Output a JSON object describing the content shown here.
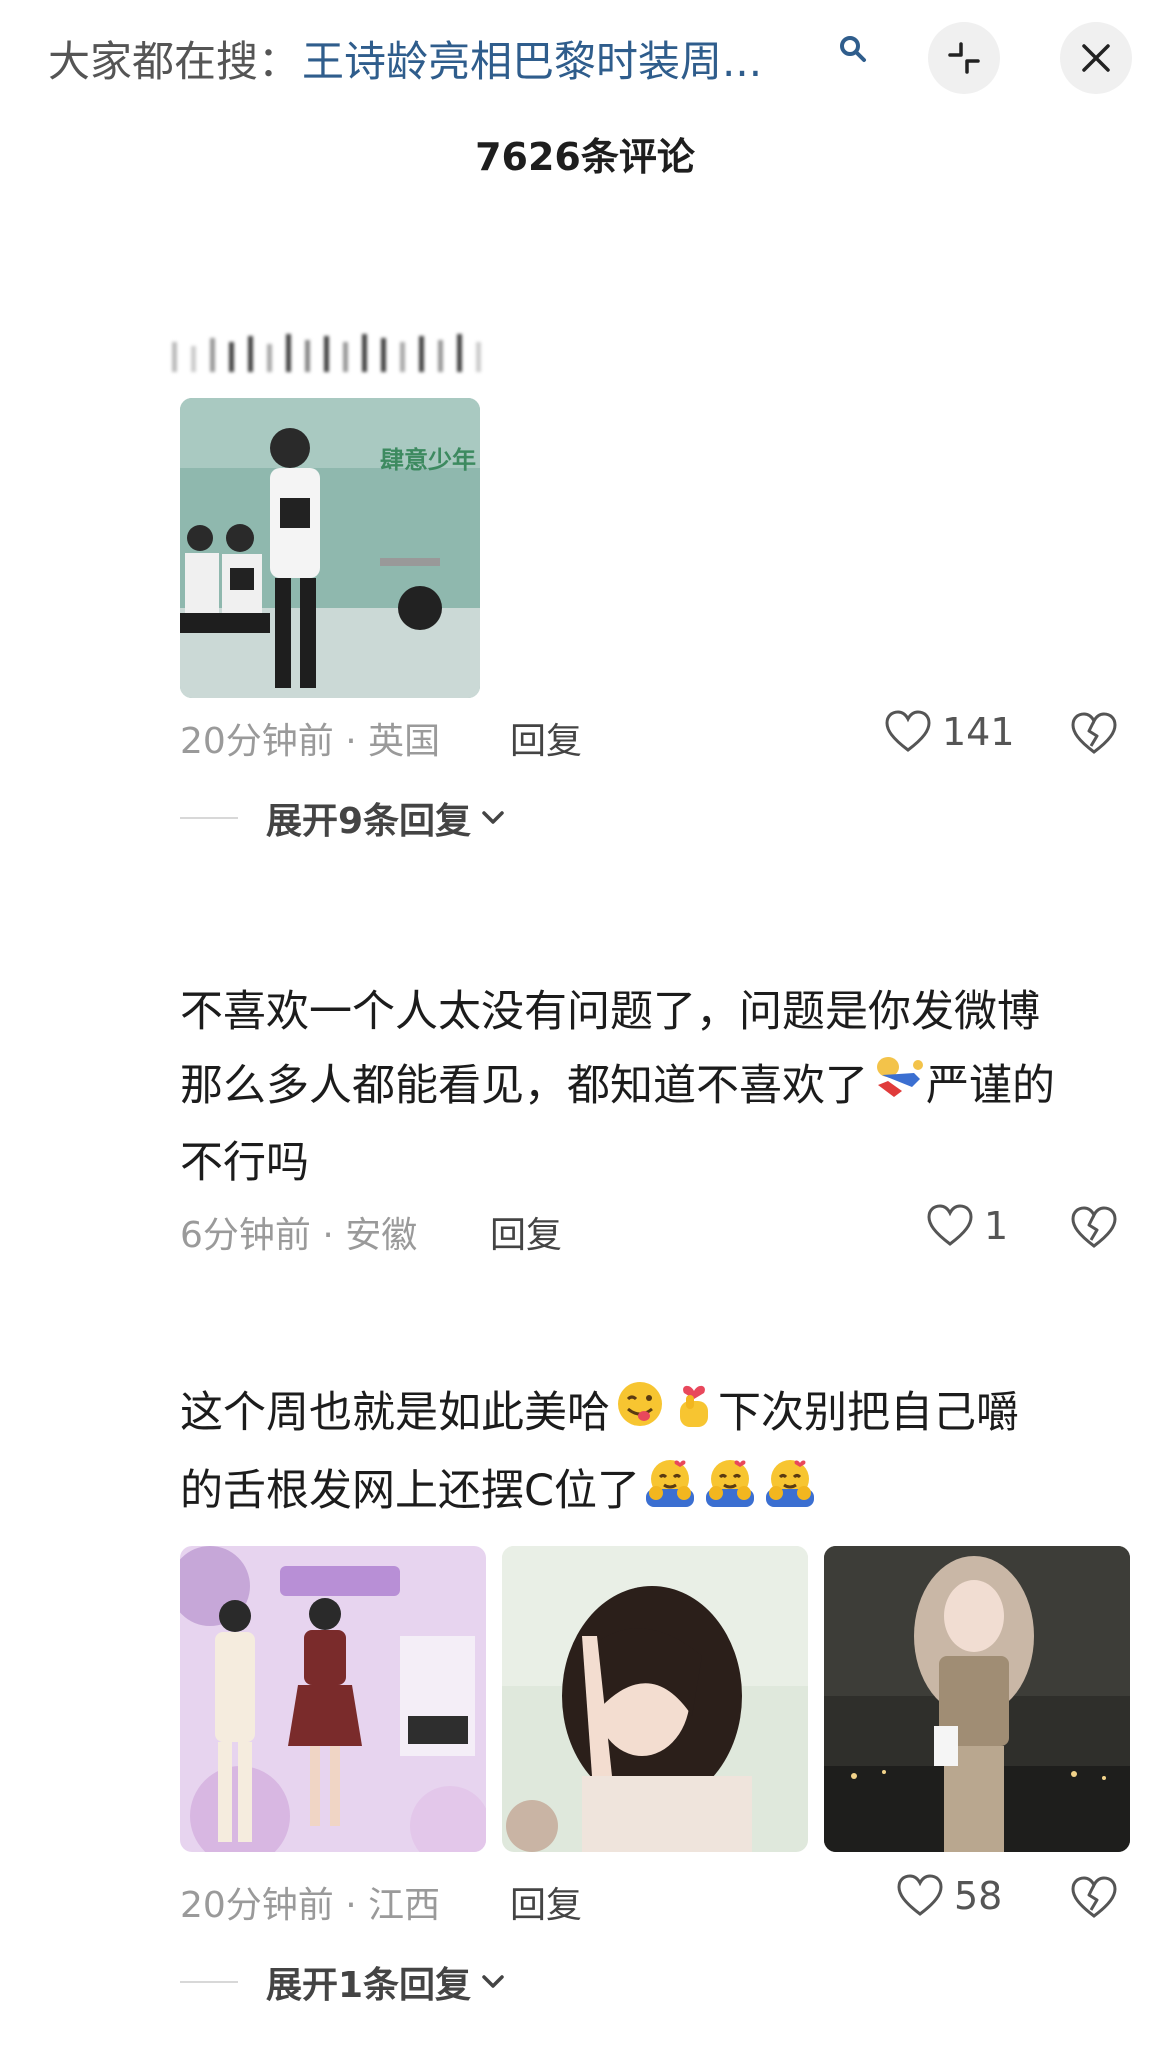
{
  "header": {
    "search_prefix": "大家都在搜：",
    "search_term": "王诗龄亮相巴黎时装周...",
    "comment_count": "7626条评论"
  },
  "comments": [
    {
      "time_location": "20分钟前 · 英国",
      "reply_label": "回复",
      "likes": "141",
      "expand_label": "展开9条回复"
    },
    {
      "text_line1": "不喜欢一个人太没有问题了，问题是你发微博",
      "text_line2a": "那么多人都能看见，都知道不喜欢了",
      "text_line2b": "严谨的",
      "text_line3": "不行吗",
      "time_location": "6分钟前 · 安徽",
      "reply_label": "回复",
      "likes": "1"
    },
    {
      "text_line1a": "这个周也就是如此美哈",
      "text_line1b": "下次别把自己嚼",
      "text_line2": "的舌根发网上还摆C位了",
      "time_location": "20分钟前 · 江西",
      "reply_label": "回复",
      "likes": "58",
      "expand_label": "展开1条回复"
    }
  ],
  "icons": {
    "search": "search-icon",
    "collapse": "collapse-icon",
    "close": "close-icon",
    "like": "heart-icon",
    "dislike": "broken-heart-icon",
    "chevron": "chevron-down-icon"
  },
  "colors": {
    "link_blue": "#2f5d8c",
    "meta_gray": "#9a9a9a",
    "button_bg": "#f0f0f0"
  }
}
